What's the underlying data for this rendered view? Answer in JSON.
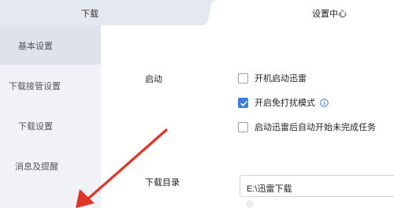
{
  "tabs": [
    {
      "label": "下载",
      "active": false
    },
    {
      "label": "设置中心",
      "active": true
    }
  ],
  "sidebar": {
    "items": [
      {
        "label": "基本设置",
        "active": true
      },
      {
        "label": "下载接管设置",
        "active": false
      },
      {
        "label": "下载设置",
        "active": false
      },
      {
        "label": "消息及提醒",
        "active": false
      }
    ]
  },
  "settings": {
    "startup": {
      "label": "启动",
      "options": [
        {
          "text": "开机启动迅雷",
          "checked": false
        },
        {
          "text": "开启免打扰模式",
          "checked": true,
          "icon": "info-icon"
        },
        {
          "text": "启动迅雷后自动开始未完成任务",
          "checked": false
        }
      ]
    },
    "download_dir": {
      "label": "下载目录",
      "value": "E:\\迅雷下载"
    }
  },
  "colors": {
    "accent": "#3a7ee0",
    "annotation_arrow": "#e0342a",
    "sidebar_bg": "#f0f2f6",
    "sidebar_active": "#dde2ec",
    "inactive_tab": "#e4e8ef"
  }
}
